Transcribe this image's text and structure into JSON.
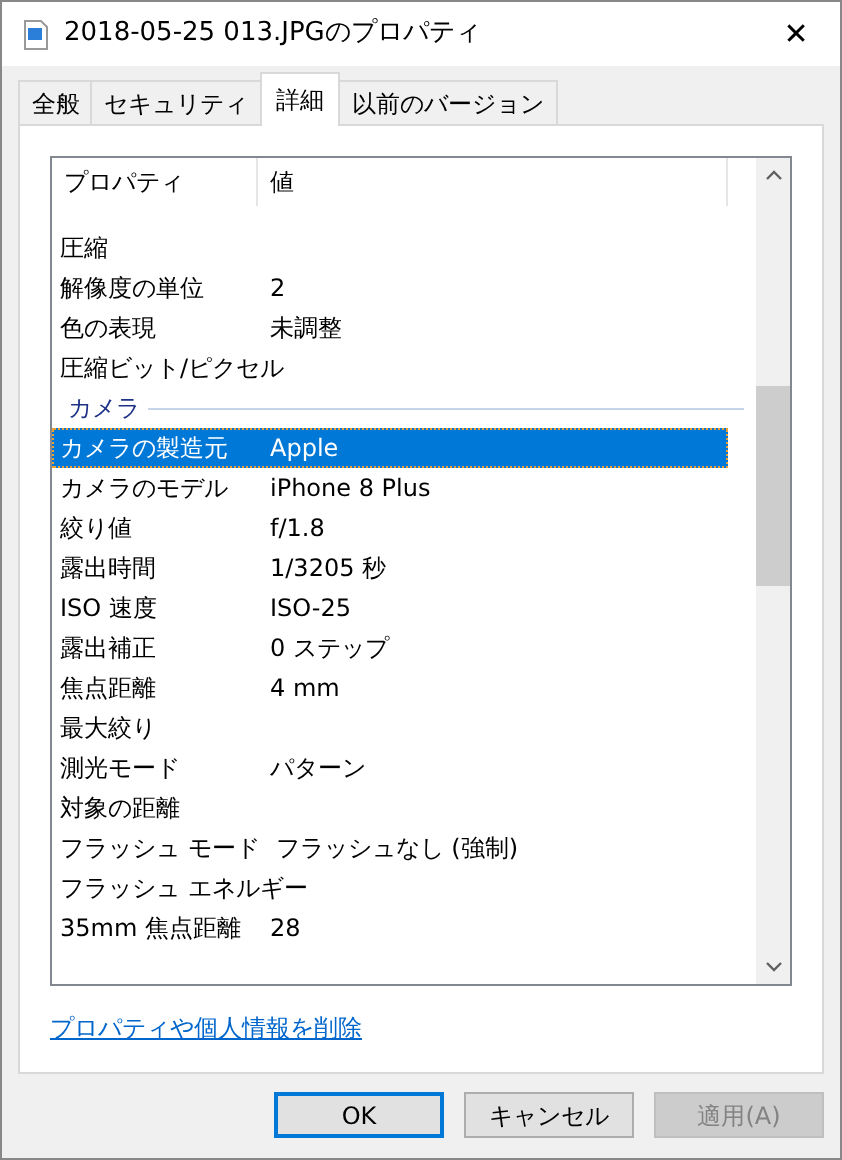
{
  "window": {
    "title": "2018-05-25 013.JPGのプロパティ",
    "close": "✕"
  },
  "tabs": [
    {
      "label": "全般",
      "selected": false
    },
    {
      "label": "セキュリティ",
      "selected": false
    },
    {
      "label": "詳細",
      "selected": true
    },
    {
      "label": "以前のバージョン",
      "selected": false
    }
  ],
  "table": {
    "columns": [
      "プロパティ",
      "値"
    ],
    "rows": [
      {
        "kind": "property",
        "name": "圧縮",
        "value": "",
        "selected": false
      },
      {
        "kind": "property",
        "name": "解像度の単位",
        "value": "2",
        "selected": false
      },
      {
        "kind": "property",
        "name": "色の表現",
        "value": "未調整",
        "selected": false
      },
      {
        "kind": "property",
        "name": "圧縮ビット/ピクセル",
        "value": "",
        "selected": false
      },
      {
        "kind": "group",
        "name": "カメラ",
        "value": ""
      },
      {
        "kind": "property",
        "name": "カメラの製造元",
        "value": "Apple",
        "selected": true
      },
      {
        "kind": "property",
        "name": "カメラのモデル",
        "value": "iPhone 8 Plus",
        "selected": false
      },
      {
        "kind": "property",
        "name": "絞り値",
        "value": "f/1.8",
        "selected": false
      },
      {
        "kind": "property",
        "name": "露出時間",
        "value": "1/3205 秒",
        "selected": false
      },
      {
        "kind": "property",
        "name": "ISO 速度",
        "value": "ISO-25",
        "selected": false
      },
      {
        "kind": "property",
        "name": "露出補正",
        "value": "0 ステップ",
        "selected": false
      },
      {
        "kind": "property",
        "name": "焦点距離",
        "value": "4 mm",
        "selected": false
      },
      {
        "kind": "property",
        "name": "最大絞り",
        "value": "",
        "selected": false
      },
      {
        "kind": "property",
        "name": "測光モード",
        "value": "パターン",
        "selected": false
      },
      {
        "kind": "property",
        "name": "対象の距離",
        "value": "",
        "selected": false
      },
      {
        "kind": "property",
        "name": "フラッシュ モード",
        "value": "フラッシュなし (強制)",
        "selected": false
      },
      {
        "kind": "property",
        "name": "フラッシュ エネルギー",
        "value": "",
        "selected": false
      },
      {
        "kind": "property",
        "name": "35mm 焦点距離",
        "value": "28",
        "selected": false
      }
    ]
  },
  "link": "プロパティや個人情報を削除",
  "buttons": [
    {
      "label": "OK",
      "default": true,
      "disabled": false
    },
    {
      "label": "キャンセル",
      "default": false,
      "disabled": false
    },
    {
      "label": "適用(A)",
      "default": false,
      "disabled": true
    }
  ]
}
